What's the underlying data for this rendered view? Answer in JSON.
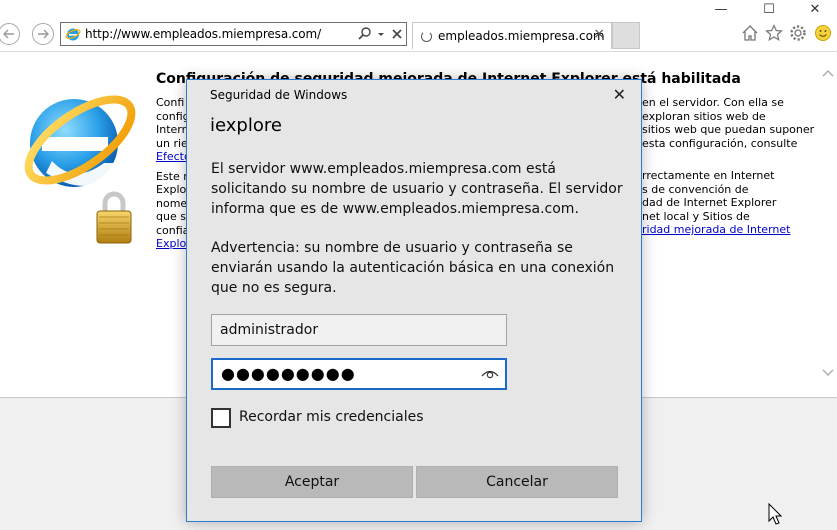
{
  "browser": {
    "address_url": "http://www.empleados.miempresa.com/",
    "tab_title": "empleados.miempresa.com",
    "tab_close": "×",
    "minimize": "—",
    "maximize": "☐",
    "close": "✕"
  },
  "page": {
    "title": "Configuración de seguridad mejorada de Internet Explorer está habilitada",
    "col_left": [
      "Confi",
      "config",
      "Intern",
      "un rie",
      "Efecto",
      "",
      "Este n",
      "Explor",
      "nome",
      "que s",
      "confia",
      "Explo"
    ],
    "col_right": [
      "en el servidor. Con ella se",
      "exploran sitios web de",
      "sitios web que puedan suponer",
      "esta configuración, consulte",
      "",
      "",
      "rrectamente en Internet",
      "s de convención de",
      "dad de Internet Explorer",
      "net local y Sitios de",
      "ridad mejorada de Internet"
    ]
  },
  "dialog": {
    "caption": "Seguridad de Windows",
    "close_glyph": "✕",
    "app_name": "iexplore",
    "message": "El servidor www.empleados.miempresa.com está solicitando su nombre de usuario y contraseña. El servidor informa que es de www.empleados.miempresa.com.",
    "warning": "Advertencia: su nombre de usuario y contraseña se enviarán usando la autenticación básica en una conexión que no es segura.",
    "username_value": "administrador",
    "password_mask": "●●●●●●●●●",
    "remember_label": "Recordar mis credenciales",
    "remember_checked": false,
    "ok_label": "Aceptar",
    "cancel_label": "Cancelar"
  },
  "icons": [
    "back-arrow-icon",
    "forward-arrow-icon",
    "ie-favicon-icon",
    "search-icon",
    "dropdown-icon",
    "stop-icon",
    "loading-spinner-icon",
    "home-icon",
    "favorites-star-icon",
    "settings-gear-icon",
    "smiley-feedback-icon",
    "internet-explorer-logo",
    "padlock-icon",
    "password-reveal-eye-icon",
    "mouse-cursor-icon"
  ],
  "colors": {
    "accent_blue": "#1b6ac9",
    "dialog_bg": "#e6e6e6",
    "button_bg": "#b9b9b9",
    "link": "#0000cc"
  }
}
